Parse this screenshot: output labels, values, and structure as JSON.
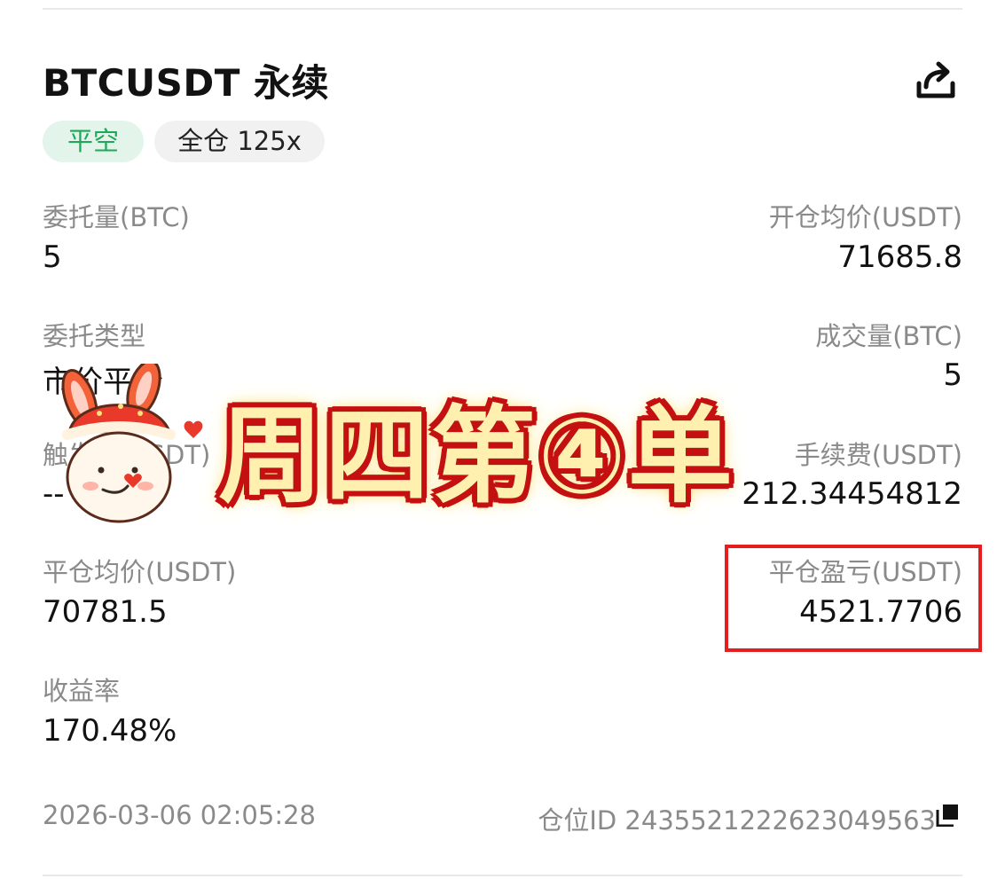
{
  "header": {
    "title": "BTCUSDT 永续",
    "tags": {
      "side": "平空",
      "margin": "全仓 125x"
    }
  },
  "fields": {
    "order_qty": {
      "label": "委托量(BTC)",
      "value": "5"
    },
    "open_avg_price": {
      "label": "开仓均价(USDT)",
      "value": "71685.8"
    },
    "order_type": {
      "label": "委托类型",
      "value": "市价平仓"
    },
    "filled_qty": {
      "label": "成交量(BTC)",
      "value": "5"
    },
    "trigger": {
      "label": "触发价(USDT)",
      "value": "--"
    },
    "fee": {
      "label": "手续费(USDT)",
      "value": "212.34454812"
    },
    "close_avg_price": {
      "label": "平仓均价(USDT)",
      "value": "70781.5"
    },
    "close_pnl": {
      "label": "平仓盈亏(USDT)",
      "value": "4521.7706"
    },
    "roi": {
      "label": "收益率",
      "value": "170.48%"
    }
  },
  "footer": {
    "datetime": "2026-03-06 02:05:28",
    "position_id": "仓位ID 2435521222623049563"
  },
  "overlay": {
    "banner_text": "周四第④单"
  },
  "icons": {
    "share": "share-icon",
    "copy": "copy-icon",
    "sticker": "bunny-sticker"
  },
  "colors": {
    "tag_green": "#1fa85a",
    "highlight_red": "#e51f1f"
  }
}
